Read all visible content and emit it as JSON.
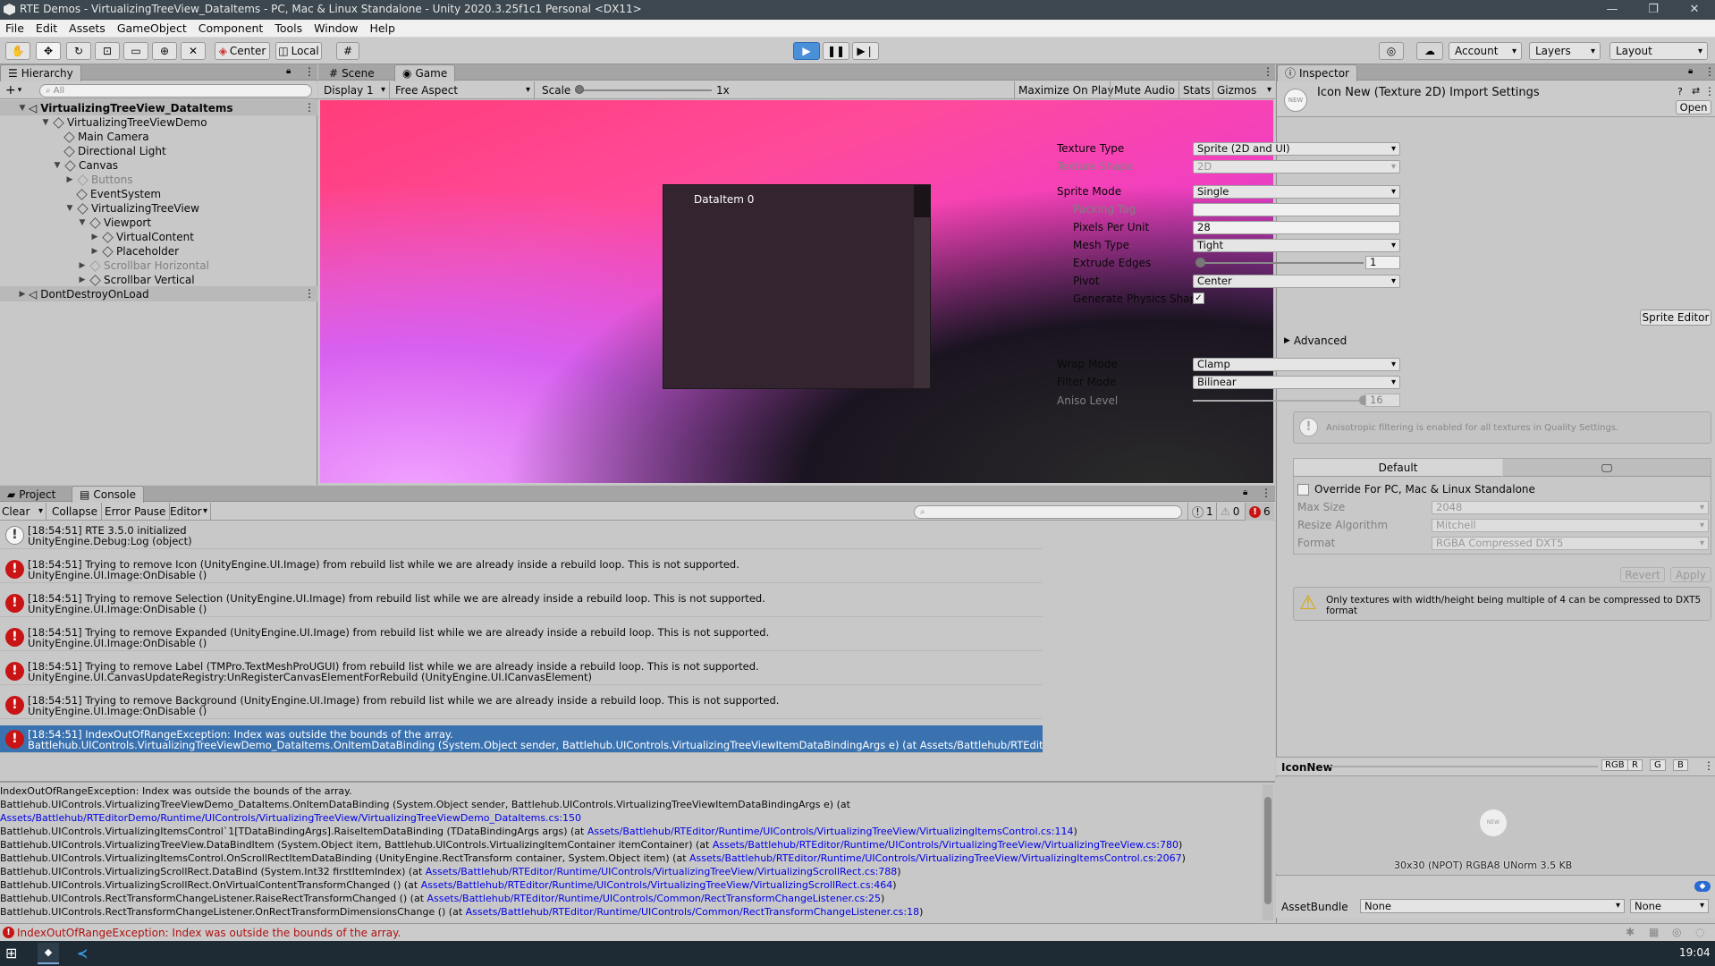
{
  "titlebar": {
    "title": "RTE Demos - VirtualizingTreeView_DataItems - PC, Mac & Linux Standalone - Unity 2020.3.25f1c1 Personal <DX11>"
  },
  "menu": [
    "File",
    "Edit",
    "Assets",
    "GameObject",
    "Component",
    "Tools",
    "Window",
    "Help"
  ],
  "toolbar": {
    "pivot": "Center",
    "space": "Local",
    "account": "Account",
    "layers": "Layers",
    "layout": "Layout"
  },
  "hierarchy": {
    "tab": "Hierarchy",
    "search_placeholder": "All",
    "items": [
      {
        "label": "VirtualizingTreeView_DataItems"
      },
      {
        "label": "VirtualizingTreeViewDemo"
      },
      {
        "label": "Main Camera"
      },
      {
        "label": "Directional Light"
      },
      {
        "label": "Canvas"
      },
      {
        "label": "Buttons"
      },
      {
        "label": "EventSystem"
      },
      {
        "label": "VirtualizingTreeView"
      },
      {
        "label": "Viewport"
      },
      {
        "label": "VirtualContent"
      },
      {
        "label": "Placeholder"
      },
      {
        "label": "Scrollbar Horizontal"
      },
      {
        "label": "Scrollbar Vertical"
      },
      {
        "label": "DontDestroyOnLoad"
      }
    ]
  },
  "game": {
    "tabs": [
      "Scene",
      "Game"
    ],
    "display": "Display 1",
    "aspect": "Free Aspect",
    "scale_label": "Scale",
    "scale_value": "1x",
    "options": [
      "Maximize On Play",
      "Mute Audio",
      "Stats",
      "Gizmos"
    ],
    "data_item": "DataItem 0"
  },
  "inspector": {
    "tab": "Inspector",
    "title": "Icon New (Texture 2D) Import Settings",
    "open": "Open",
    "rows": [
      {
        "label": "Texture Type",
        "value": "Sprite (2D and UI)"
      },
      {
        "label": "Texture Shape",
        "value": "2D"
      },
      {
        "label": "Sprite Mode",
        "value": "Single"
      },
      {
        "label": "Packing Tag",
        "value": ""
      },
      {
        "label": "Pixels Per Unit",
        "value": "28"
      },
      {
        "label": "Mesh Type",
        "value": "Tight"
      },
      {
        "label": "Extrude Edges",
        "value": "1"
      },
      {
        "label": "Pivot",
        "value": "Center"
      },
      {
        "label": "Generate Physics Shape",
        "value": ""
      }
    ],
    "sprite_editor": "Sprite Editor",
    "advanced": "Advanced",
    "rows2": [
      {
        "label": "Wrap Mode",
        "value": "Clamp"
      },
      {
        "label": "Filter Mode",
        "value": "Bilinear"
      },
      {
        "label": "Aniso Level",
        "value": "16"
      }
    ],
    "aniso_note": "Anisotropic filtering is enabled for all textures in Quality Settings.",
    "platform_default": "Default",
    "override": "Override For PC, Mac & Linux Standalone",
    "rows3": [
      {
        "label": "Max Size",
        "value": "2048"
      },
      {
        "label": "Resize Algorithm",
        "value": "Mitchell"
      },
      {
        "label": "Format",
        "value": "RGBA Compressed DXT5"
      }
    ],
    "revert": "Revert",
    "apply": "Apply",
    "warning": "Only textures with width/height being multiple of 4 can be compressed to DXT5 format",
    "preview_name": "IconNew",
    "channels": [
      "RGB",
      "R",
      "G",
      "B"
    ],
    "preview_info": "30x30 (NPOT)  RGBA8 UNorm  3.5 KB",
    "assetbundle_label": "AssetBundle",
    "assetbundle_value": "None",
    "assetbundle_variant": "None"
  },
  "console": {
    "tabs": [
      "Project",
      "Console"
    ],
    "buttons": [
      "Clear",
      "Collapse",
      "Error Pause",
      "Editor"
    ],
    "counts": {
      "info": "1",
      "warn": "0",
      "error": "6"
    },
    "entries": [
      {
        "type": "info",
        "l1": "[18:54:51] RTE 3.5.0 initialized",
        "l2": "UnityEngine.Debug:Log (object)"
      },
      {
        "type": "error",
        "l1": "[18:54:51] Trying to remove Icon (UnityEngine.UI.Image) from rebuild list while we are already inside a rebuild loop. This is not supported.",
        "l2": "UnityEngine.UI.Image:OnDisable ()"
      },
      {
        "type": "error",
        "l1": "[18:54:51] Trying to remove Selection (UnityEngine.UI.Image) from rebuild list while we are already inside a rebuild loop. This is not supported.",
        "l2": "UnityEngine.UI.Image:OnDisable ()"
      },
      {
        "type": "error",
        "l1": "[18:54:51] Trying to remove Expanded (UnityEngine.UI.Image) from rebuild list while we are already inside a rebuild loop. This is not supported.",
        "l2": "UnityEngine.UI.Image:OnDisable ()"
      },
      {
        "type": "error",
        "l1": "[18:54:51] Trying to remove Label (TMPro.TextMeshProUGUI) from rebuild list while we are already inside a rebuild loop. This is not supported.",
        "l2": "UnityEngine.UI.CanvasUpdateRegistry:UnRegisterCanvasElementForRebuild (UnityEngine.UI.ICanvasElement)"
      },
      {
        "type": "error",
        "l1": "[18:54:51] Trying to remove Background (UnityEngine.UI.Image) from rebuild list while we are already inside a rebuild loop. This is not supported.",
        "l2": "UnityEngine.UI.Image:OnDisable ()"
      },
      {
        "type": "error",
        "l1": "[18:54:51] IndexOutOfRangeException: Index was outside the bounds of the array.",
        "l2": "Battlehub.UIControls.VirtualizingTreeViewDemo_DataItems.OnItemDataBinding (System.Object sender, Battlehub.UIControls.VirtualizingTreeViewItemDataBindingArgs e) (at Assets/Battlehub/RTEditorDemo/Runtime/UIControls/VirtualizingTreeView/"
      }
    ],
    "stack": [
      {
        "t": "IndexOutOfRangeException: Index was outside the bounds of the array.",
        "l": ""
      },
      {
        "t": "Battlehub.UIControls.VirtualizingTreeViewDemo_DataItems.OnItemDataBinding (System.Object sender, Battlehub.UIControls.VirtualizingTreeViewItemDataBindingArgs e) (at",
        "l": ""
      },
      {
        "t": "",
        "l": "Assets/Battlehub/RTEditorDemo/Runtime/UIControls/VirtualizingTreeView/VirtualizingTreeViewDemo_DataItems.cs:150"
      },
      {
        "t": "Battlehub.UIControls.VirtualizingItemsControl`1[TDataBindingArgs].RaiseItemDataBinding (TDataBindingArgs args) (at ",
        "l": "Assets/Battlehub/RTEditor/Runtime/UIControls/VirtualizingTreeView/VirtualizingItemsControl.cs:114"
      },
      {
        "t": "Battlehub.UIControls.VirtualizingTreeView.DataBindItem (System.Object item, Battlehub.UIControls.VirtualizingItemContainer itemContainer) (at ",
        "l": "Assets/Battlehub/RTEditor/Runtime/UIControls/VirtualizingTreeView/VirtualizingTreeView.cs:780"
      },
      {
        "t": "Battlehub.UIControls.VirtualizingItemsControl.OnScrollRectItemDataBinding (UnityEngine.RectTransform container, System.Object item) (at ",
        "l": "Assets/Battlehub/RTEditor/Runtime/UIControls/VirtualizingTreeView/VirtualizingItemsControl.cs:2067"
      },
      {
        "t": "Battlehub.UIControls.VirtualizingScrollRect.DataBind (System.Int32 firstItemIndex) (at ",
        "l": "Assets/Battlehub/RTEditor/Runtime/UIControls/VirtualizingTreeView/VirtualizingScrollRect.cs:788"
      },
      {
        "t": "Battlehub.UIControls.VirtualizingScrollRect.OnVirtualContentTransformChanged () (at ",
        "l": "Assets/Battlehub/RTEditor/Runtime/UIControls/VirtualizingTreeView/VirtualizingScrollRect.cs:464"
      },
      {
        "t": "Battlehub.UIControls.RectTransformChangeListener.RaiseRectTransformChanged () (at ",
        "l": "Assets/Battlehub/RTEditor/Runtime/UIControls/Common/RectTransformChangeListener.cs:25"
      },
      {
        "t": "Battlehub.UIControls.RectTransformChangeListener.OnRectTransformDimensionsChange () (at ",
        "l": "Assets/Battlehub/RTEditor/Runtime/UIControls/Common/RectTransformChangeListener.cs:18"
      }
    ]
  },
  "statusbar": {
    "message": "IndexOutOfRangeException: Index was outside the bounds of the array."
  },
  "taskbar": {
    "time": "19:04"
  }
}
